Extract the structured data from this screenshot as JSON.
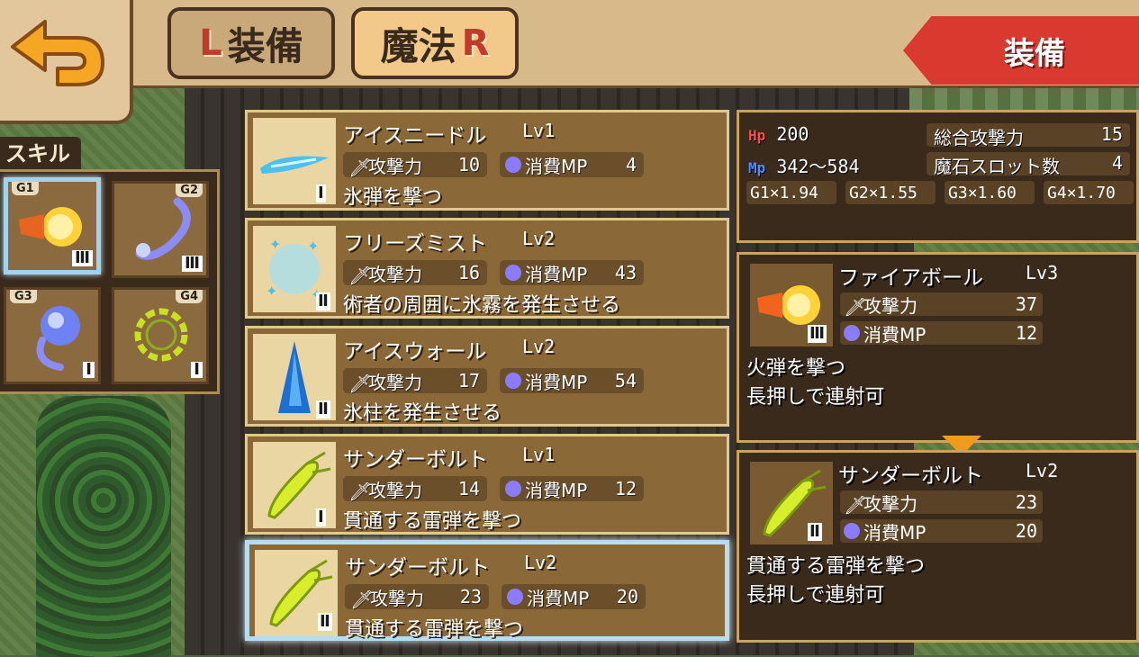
{
  "header": {
    "tab_equip_key": "L",
    "tab_equip_label": "装備",
    "tab_magic_label": "魔法",
    "tab_magic_key": "R",
    "ribbon_label": "装備"
  },
  "skills": {
    "label": "スキル",
    "slots": [
      {
        "tag": "G1",
        "rank": "Ⅲ",
        "icon": "fireball-icon"
      },
      {
        "tag": "G2",
        "rank": "Ⅲ",
        "icon": "ice-swirl-icon"
      },
      {
        "tag": "G3",
        "rank": "Ⅰ",
        "icon": "ice-orb-icon"
      },
      {
        "tag": "G4",
        "rank": "Ⅰ",
        "icon": "lightning-ring-icon"
      }
    ]
  },
  "spells": [
    {
      "name": "アイスニードル",
      "lv": "Lv1",
      "atk_label": "攻撃力",
      "atk": "10",
      "mp_label": "消費MP",
      "mp": "4",
      "rank": "Ⅰ",
      "desc": "氷弾を撃つ",
      "icon": "ice-needle-icon"
    },
    {
      "name": "フリーズミスト",
      "lv": "Lv2",
      "atk_label": "攻撃力",
      "atk": "16",
      "mp_label": "消費MP",
      "mp": "43",
      "rank": "Ⅱ",
      "desc": "術者の周囲に氷霧を発生させる",
      "icon": "freeze-mist-icon"
    },
    {
      "name": "アイスウォール",
      "lv": "Lv2",
      "atk_label": "攻撃力",
      "atk": "17",
      "mp_label": "消費MP",
      "mp": "54",
      "rank": "Ⅱ",
      "desc": "氷柱を発生させる",
      "icon": "ice-wall-icon"
    },
    {
      "name": "サンダーボルト",
      "lv": "Lv1",
      "atk_label": "攻撃力",
      "atk": "14",
      "mp_label": "消費MP",
      "mp": "12",
      "rank": "Ⅰ",
      "desc": "貫通する雷弾を撃つ",
      "icon": "thunderbolt-icon"
    },
    {
      "name": "サンダーボルト",
      "lv": "Lv2",
      "atk_label": "攻撃力",
      "atk": "23",
      "mp_label": "消費MP",
      "mp": "20",
      "rank": "Ⅱ",
      "desc": "貫通する雷弾を撃つ",
      "icon": "thunderbolt-icon"
    }
  ],
  "status": {
    "hp_label": "Hp",
    "hp": "200",
    "mp_label": "Mp",
    "mp": "342〜584",
    "total_atk_label": "総合攻撃力",
    "total_atk": "15",
    "slots_label": "魔石スロット数",
    "slots": "4",
    "gear": [
      {
        "key": "G1",
        "mult": "1.94"
      },
      {
        "key": "G2",
        "mult": "1.55"
      },
      {
        "key": "G3",
        "mult": "1.60"
      },
      {
        "key": "G4",
        "mult": "1.70"
      }
    ]
  },
  "current": {
    "name": "ファイアボール",
    "lv": "Lv3",
    "atk_label": "攻撃力",
    "atk": "37",
    "mp_label": "消費MP",
    "mp": "12",
    "rank": "Ⅲ",
    "desc1": "火弾を撃つ",
    "desc2": "長押しで連射可",
    "icon": "fireball-icon"
  },
  "candidate": {
    "name": "サンダーボルト",
    "lv": "Lv2",
    "atk_label": "攻撃力",
    "atk": "23",
    "mp_label": "消費MP",
    "mp": "20",
    "rank": "Ⅱ",
    "desc1": "貫通する雷弾を撃つ",
    "desc2": "長押しで連射可",
    "icon": "thunderbolt-icon"
  },
  "colors": {
    "accent_red": "#d9392e",
    "frame_gold": "#c9a45f",
    "panel_brown": "#3a2a1c"
  }
}
